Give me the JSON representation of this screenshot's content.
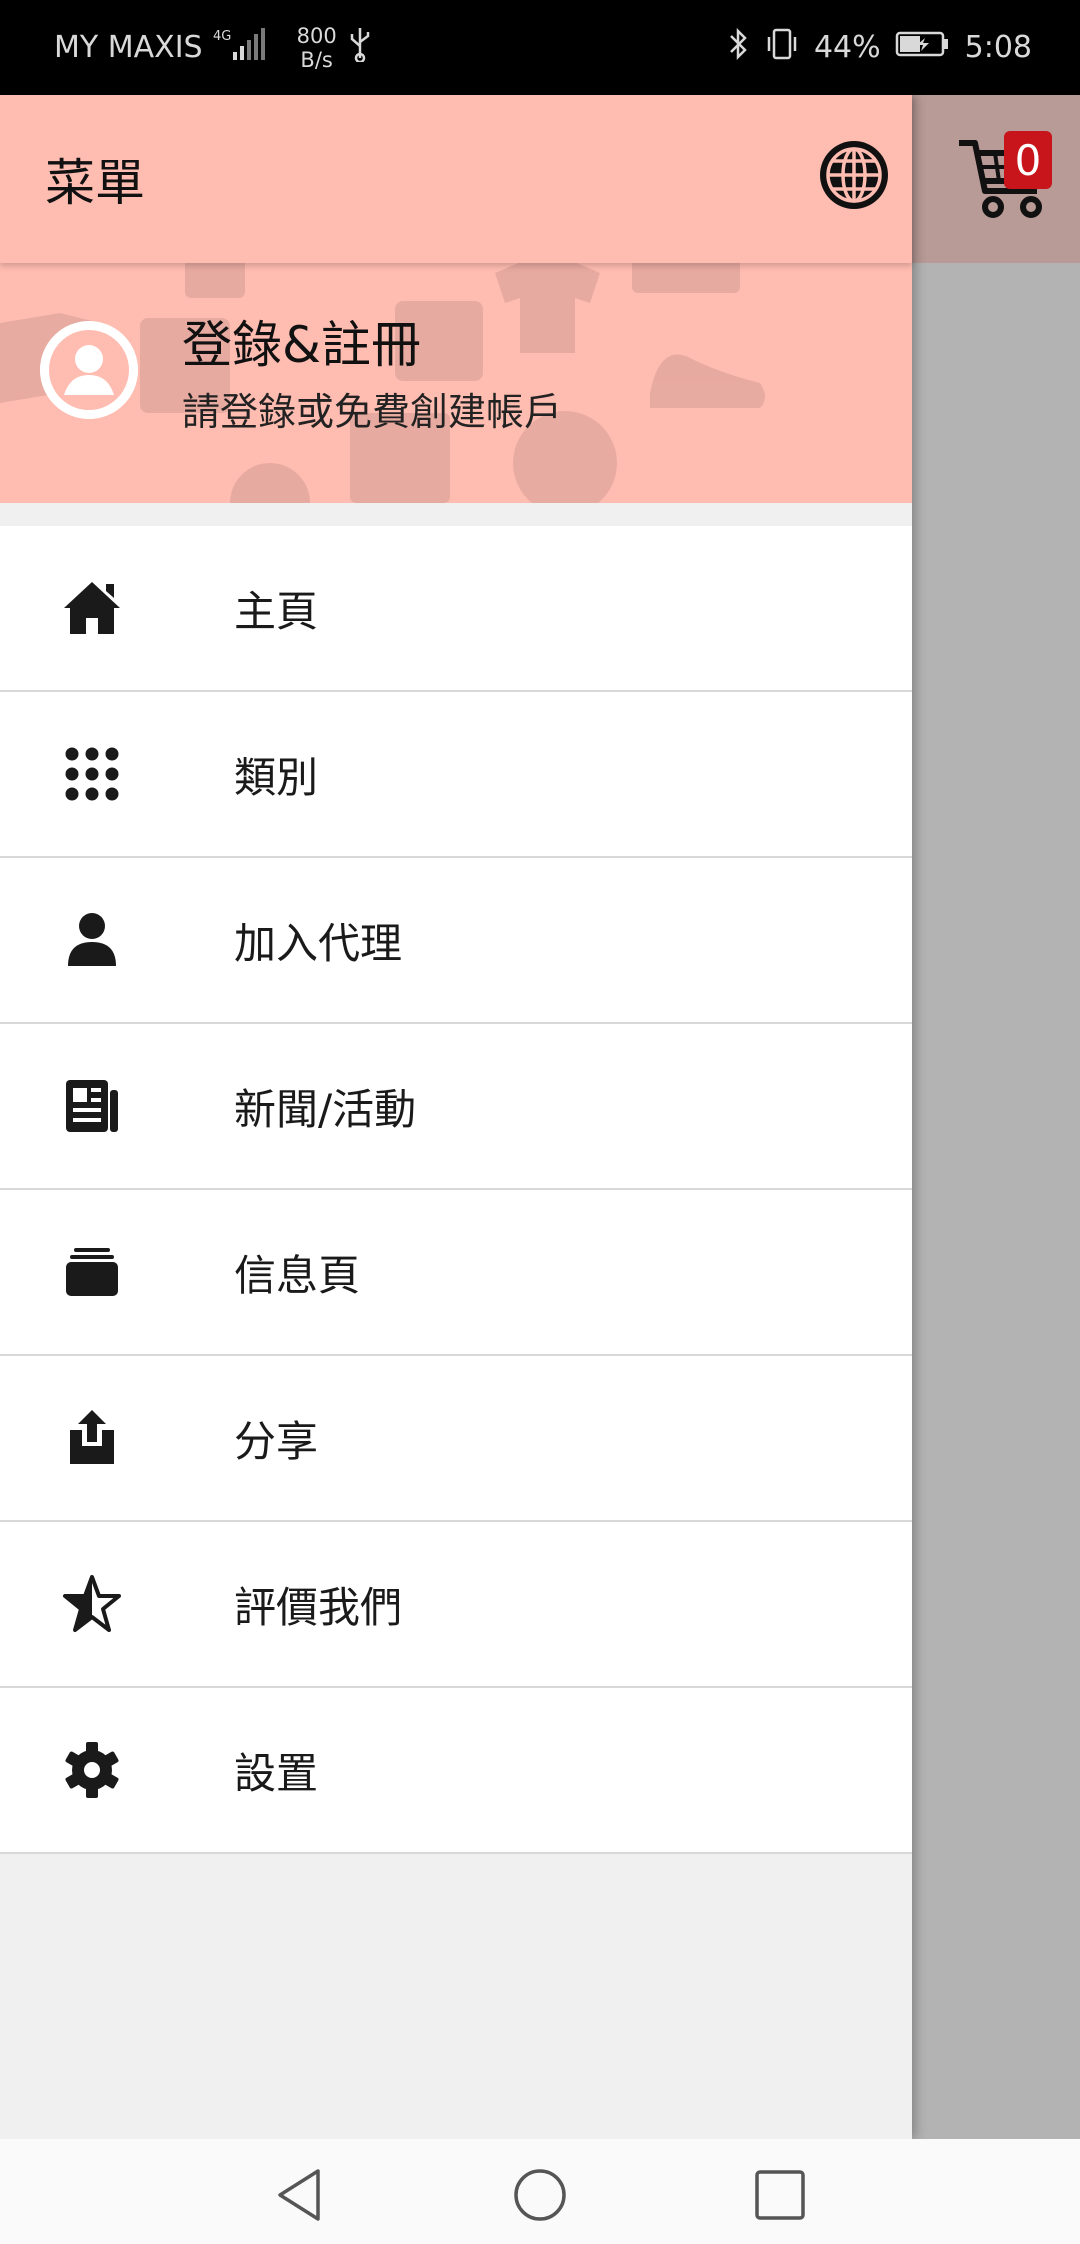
{
  "status_bar": {
    "carrier": "MY MAXIS",
    "network": "4G",
    "speed_value": "800",
    "speed_unit": "B/s",
    "battery": "44%",
    "time": "5:08"
  },
  "app_bar": {
    "title": "菜單",
    "globe_icon": "globe-icon"
  },
  "cart": {
    "count": "0",
    "icon": "shopping-cart-icon"
  },
  "header": {
    "title": "登錄&註冊",
    "subtitle": "請登錄或免費創建帳戶"
  },
  "menu": {
    "items": [
      {
        "label": "主頁",
        "icon": "home-icon"
      },
      {
        "label": "類別",
        "icon": "grid-icon"
      },
      {
        "label": "加入代理",
        "icon": "person-icon"
      },
      {
        "label": "新聞/活動",
        "icon": "newspaper-icon"
      },
      {
        "label": "信息頁",
        "icon": "stack-icon"
      },
      {
        "label": "分享",
        "icon": "share-icon"
      },
      {
        "label": "評價我們",
        "icon": "star-icon"
      },
      {
        "label": "設置",
        "icon": "gear-icon"
      }
    ]
  },
  "colors": {
    "header_bg": "#ffbcb1",
    "badge": "#c8151b",
    "scrim": "#b3b3b3"
  }
}
